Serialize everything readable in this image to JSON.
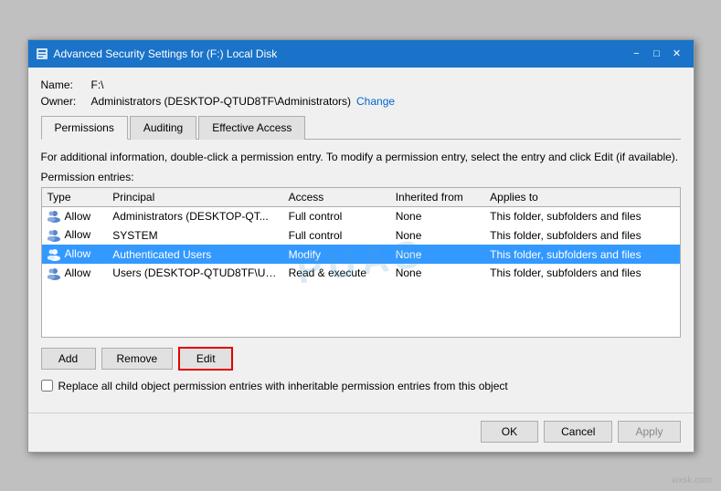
{
  "window": {
    "title": "Advanced Security Settings for (F:) Local Disk",
    "minimize_label": "−",
    "maximize_label": "□",
    "close_label": "✕"
  },
  "info": {
    "name_label": "Name:",
    "name_value": "F:\\",
    "owner_label": "Owner:",
    "owner_value": "Administrators (DESKTOP-QTUD8TF\\Administrators)",
    "change_link": "Change"
  },
  "tabs": [
    {
      "id": "permissions",
      "label": "Permissions",
      "active": true
    },
    {
      "id": "auditing",
      "label": "Auditing",
      "active": false
    },
    {
      "id": "effective-access",
      "label": "Effective Access",
      "active": false
    }
  ],
  "description": "For additional information, double-click a permission entry. To modify a permission entry, select the entry and click Edit (if available).",
  "section_label": "Permission entries:",
  "table": {
    "columns": [
      "Type",
      "Principal",
      "Access",
      "Inherited from",
      "Applies to"
    ],
    "rows": [
      {
        "type": "Allow",
        "principal": "Administrators (DESKTOP-QT...",
        "access": "Full control",
        "inherited_from": "None",
        "applies_to": "This folder, subfolders and files",
        "selected": false
      },
      {
        "type": "Allow",
        "principal": "SYSTEM",
        "access": "Full control",
        "inherited_from": "None",
        "applies_to": "This folder, subfolders and files",
        "selected": false
      },
      {
        "type": "Allow",
        "principal": "Authenticated Users",
        "access": "Modify",
        "inherited_from": "None",
        "applies_to": "This folder, subfolders and files",
        "selected": true
      },
      {
        "type": "Allow",
        "principal": "Users (DESKTOP-QTUD8TF\\Us...",
        "access": "Read & execute",
        "inherited_from": "None",
        "applies_to": "This folder, subfolders and files",
        "selected": false
      }
    ]
  },
  "buttons": {
    "add_label": "Add",
    "remove_label": "Remove",
    "edit_label": "Edit"
  },
  "checkbox": {
    "label": "Replace all child object permission entries with inheritable permission entries from this object"
  },
  "footer": {
    "ok_label": "OK",
    "cancel_label": "Cancel",
    "apply_label": "Apply"
  },
  "watermark": "PUAS"
}
